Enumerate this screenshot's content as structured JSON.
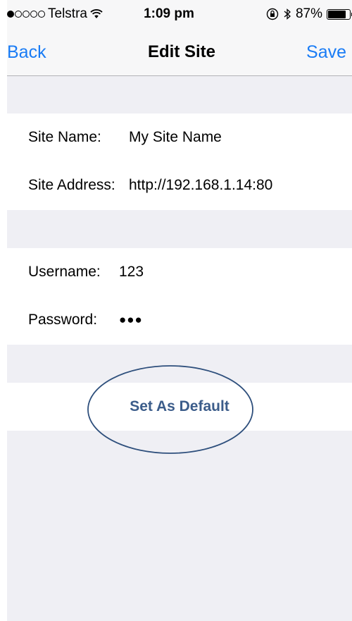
{
  "status_bar": {
    "carrier": "Telstra",
    "signal_dots_filled": 1,
    "signal_dots_total": 5,
    "time": "1:09 pm",
    "battery_percent": "87%",
    "battery_level": 0.87
  },
  "nav": {
    "back_label": "Back",
    "title": "Edit Site",
    "save_label": "Save"
  },
  "site": {
    "name_label": "Site Name:",
    "name_value": "My Site Name",
    "address_label": "Site Address:",
    "address_value": "http://192.168.1.14:80"
  },
  "credentials": {
    "username_label": "Username:",
    "username_value": "123",
    "password_label": "Password:",
    "password_value": "●●●"
  },
  "actions": {
    "set_default_label": "Set As Default"
  },
  "colors": {
    "accent": "#1a7cf5",
    "default_button_text": "#3b5c8a",
    "annotation_ellipse": "#2e4f7c",
    "grouped_background": "#efeff4"
  }
}
